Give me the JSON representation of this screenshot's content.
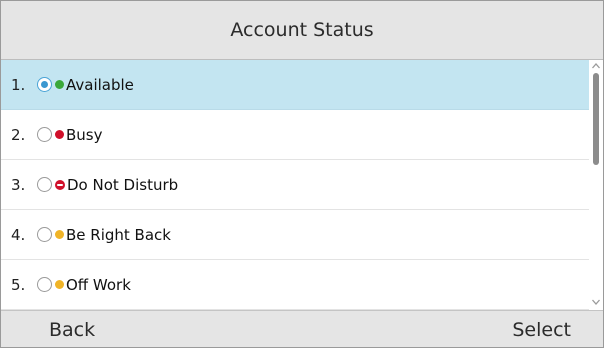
{
  "header": {
    "title": "Account Status"
  },
  "colors": {
    "available": "#3aa83a",
    "busy": "#d0102a",
    "dnd": "#d0102a",
    "away": "#f0b428",
    "offwork": "#f0b428",
    "selected_row": "#c3e5f1"
  },
  "list": {
    "items": [
      {
        "number": "1.",
        "label": "Available",
        "status_icon": "green-dot-icon",
        "checked": true
      },
      {
        "number": "2.",
        "label": "Busy",
        "status_icon": "red-dot-icon",
        "checked": false
      },
      {
        "number": "3.",
        "label": "Do Not Disturb",
        "status_icon": "do-not-disturb-icon",
        "checked": false
      },
      {
        "number": "4.",
        "label": "Be Right Back",
        "status_icon": "yellow-dot-icon",
        "checked": false
      },
      {
        "number": "5.",
        "label": "Off Work",
        "status_icon": "yellow-dot-icon",
        "checked": false
      }
    ]
  },
  "softkeys": {
    "back_label": "Back",
    "select_label": "Select"
  }
}
